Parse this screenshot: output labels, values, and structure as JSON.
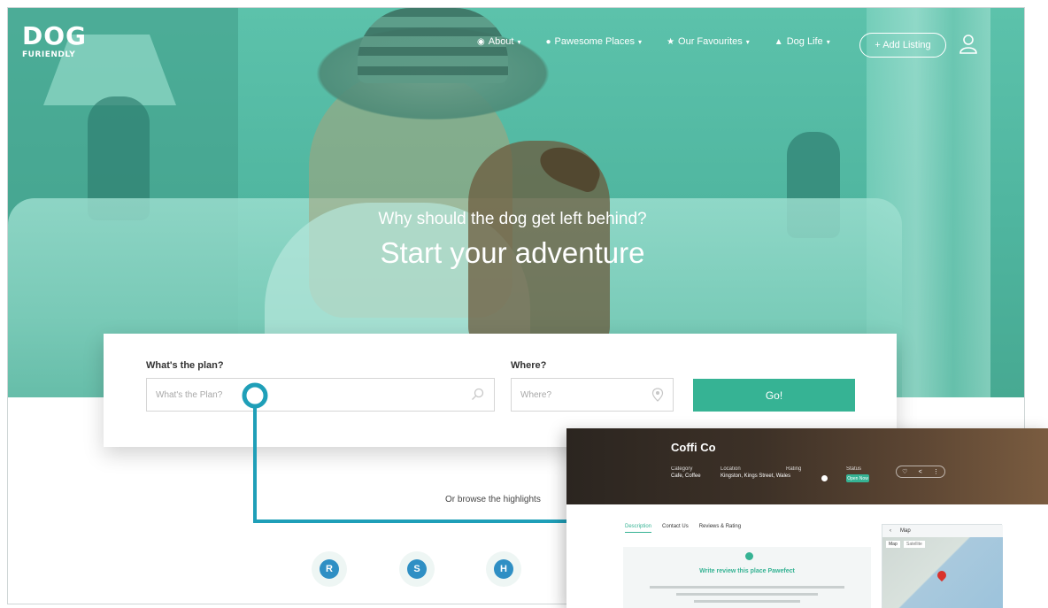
{
  "brand": {
    "logo_text": "DOG",
    "logo_sub": "FURIENDLY"
  },
  "nav": {
    "items": [
      {
        "icon": "info-icon",
        "label": "About"
      },
      {
        "icon": "paw-icon",
        "label": "Pawesome Places"
      },
      {
        "icon": "star-icon",
        "label": "Our Favourites"
      },
      {
        "icon": "dog-icon",
        "label": "Dog Life"
      }
    ],
    "add_listing": "+ Add Listing",
    "user_icon": "user-icon"
  },
  "hero": {
    "subtitle": "Why should the dog get left behind?",
    "title": "Start your adventure"
  },
  "search": {
    "plan_label": "What's the plan?",
    "plan_placeholder": "What's the Plan?",
    "where_label": "Where?",
    "where_placeholder": "Where?",
    "go_label": "Go!"
  },
  "browse": {
    "text": "Or browse the highlights"
  },
  "categories": [
    {
      "icon": "restaurant-icon",
      "glyph": "R"
    },
    {
      "icon": "shop-icon",
      "glyph": "S"
    },
    {
      "icon": "home-icon",
      "glyph": "H"
    }
  ],
  "listing": {
    "name": "Coffi Co",
    "meta": [
      {
        "key": "Category",
        "value": "Cafe, Coffee"
      },
      {
        "key": "Location",
        "value": "Kingston, Kings Street, Wales"
      },
      {
        "key": "Rating",
        "value": ""
      },
      {
        "key": "Status",
        "value": ""
      }
    ],
    "status": "Open Now",
    "tabs": [
      "Description",
      "Contact Us",
      "Reviews & Rating"
    ],
    "content_title": "Write review this place Pawefect",
    "map_title": "Map",
    "map_tabs": [
      "Map",
      "Satellite"
    ]
  },
  "colors": {
    "accent": "#36b394",
    "hero_overlay": "#4fb59f",
    "connector": "#1f9fb8"
  }
}
